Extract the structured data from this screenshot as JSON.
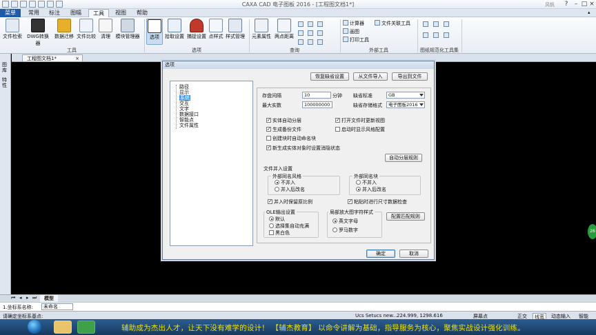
{
  "app": {
    "title": "CAXA CAD 电子图板 2016 - [工程图文档1*]",
    "user": "风帆",
    "help_icon": "?"
  },
  "menubar": {
    "tabs": [
      "菜单",
      "常用",
      "标注",
      "图幅",
      "工具",
      "视图",
      "帮助"
    ],
    "active": "工具"
  },
  "ribbon": {
    "tools_group": {
      "label": "工具",
      "buttons": [
        "文件检索",
        "DWG转换器",
        "数据迁移",
        "文件比较",
        "清理",
        "模块管理器"
      ]
    },
    "options_group": {
      "label": "选项",
      "buttons": [
        "选项",
        "拾取设置",
        "捕捉设置",
        "点样式",
        "样式管理"
      ]
    },
    "query_group": {
      "label": "查询",
      "buttons": [
        "元素属性",
        "两点距离"
      ]
    },
    "external_group": {
      "label": "外部工具",
      "buttons": [
        "计算器",
        "画图",
        "打印工具",
        "文件关联工具"
      ]
    },
    "standard_group": {
      "label": "图纸规范化工具集"
    }
  },
  "document": {
    "tab": "工程图文档1*",
    "close": "×",
    "layout_tab": "模型"
  },
  "sidepanel": {
    "items": [
      "图库",
      "特性"
    ]
  },
  "command": {
    "prompt": "1.坐标系名称:",
    "value": "未命名"
  },
  "status": {
    "hint": "请确定坐标系基点:",
    "label_ucs": "Ucs Setucs new...",
    "coords": "224.999, 1298.616",
    "point_mode": "屏幕点",
    "buttons": [
      "正交",
      "线宽",
      "动态输入",
      "智能"
    ]
  },
  "taskbar": {
    "caption": "辅助成为杰出人才，让天下没有难学的设计！   【辅杰教育】   以命令讲解为基础，指导服务为核心，聚焦实战设计强化训练。"
  },
  "badge": {
    "text": "26"
  },
  "dialog": {
    "title": "选项",
    "top_buttons": [
      "恢复缺省设置",
      "从文件导入",
      "导出到文件"
    ],
    "tree": [
      "路径",
      "显示",
      "系统",
      "交互",
      "文字",
      "数据接口",
      "智能点",
      "文件属性"
    ],
    "tree_selected": "系统",
    "save_interval_label": "存盘间隔",
    "save_interval_value": "10",
    "save_interval_unit": "分钟",
    "max_entity_label": "最大实数",
    "max_entity_value": "100000000",
    "default_standard_label": "缺省标准",
    "default_standard_value": "GB",
    "default_format_label": "缺省存储格式",
    "default_format_value": "电子图板2016",
    "checkboxes_left": [
      {
        "label": "实体自动分层",
        "checked": true
      },
      {
        "label": "生成备份文件",
        "checked": true
      },
      {
        "label": "创建块时自动命名块",
        "checked": false
      },
      {
        "label": "新生成实体对象时设置消隐状态",
        "checked": true
      }
    ],
    "checkboxes_right": [
      {
        "label": "打开文件时更新视图",
        "checked": true
      },
      {
        "label": "启动时显示风格配置",
        "checked": false
      }
    ],
    "auto_layer_button": "自动分层规则",
    "merge_section": {
      "title": "文件并入设置",
      "external_style": {
        "title": "外部同名风格",
        "options": [
          "不并入",
          "并入后改名"
        ],
        "selected": "不并入"
      },
      "external_block": {
        "title": "外部同名块",
        "options": [
          "不并入",
          "并入后改名"
        ],
        "selected": "并入后改名"
      },
      "keep_scale": {
        "label": "并入时保留原比例",
        "checked": true
      },
      "paste_size_check": {
        "label": "粘贴时进行尺寸数据检查",
        "checked": true
      }
    },
    "ole_section": {
      "title": "OLE输出设置",
      "options": [
        "默认",
        "选择集自动充满"
      ],
      "selected": "默认",
      "bw": {
        "label": "黑白色",
        "checked": false
      }
    },
    "exploded_section": {
      "title": "局部放大图字符样式",
      "options": [
        "英文字母",
        "罗马数字"
      ],
      "selected": "英文字母"
    },
    "match_rule_button": "配置匹配规则",
    "ok": "确定",
    "cancel": "取消"
  }
}
